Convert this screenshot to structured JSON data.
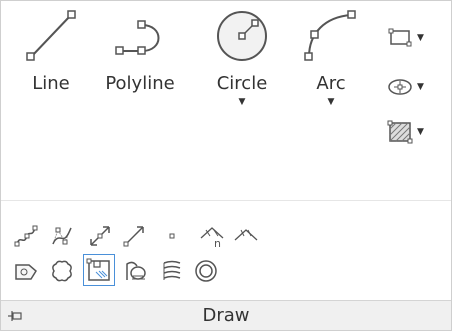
{
  "ribbon": {
    "panel_title": "Draw",
    "large_tools": [
      {
        "label": "Line"
      },
      {
        "label": "Polyline"
      },
      {
        "label": "Circle"
      },
      {
        "label": "Arc"
      }
    ],
    "colors": {
      "stroke": "#555555",
      "accent": "#4a90d9",
      "bg": "#ffffff",
      "footer_bg": "#f0f0f0"
    },
    "row1_icons": [
      "spline-fit-icon",
      "spline-cv-icon",
      "construction-line-icon",
      "ray-icon",
      "point-icon",
      "divide-icon",
      "measure-icon"
    ],
    "row2_icons": [
      "region-icon",
      "revision-cloud-icon",
      "boundary-icon",
      "hatch-icon",
      "gradient-icon",
      "donut-icon"
    ],
    "side_icons": [
      "rectangle-icon",
      "ellipse-icon",
      "hatch-dropdown-icon"
    ]
  }
}
